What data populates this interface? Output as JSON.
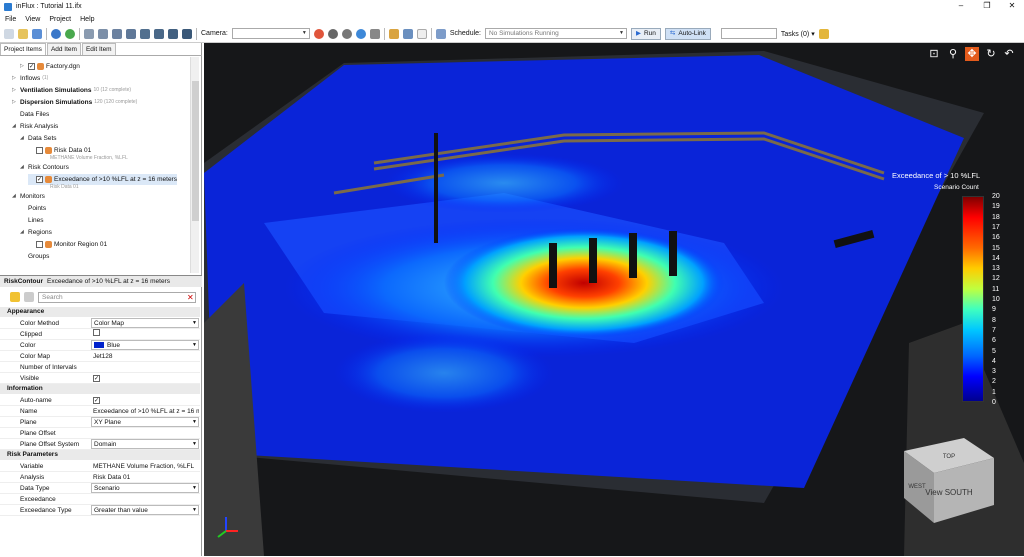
{
  "window": {
    "title": "inFlux : Tutorial 11.ifx",
    "controls": [
      "–",
      "❐",
      "✕"
    ]
  },
  "menu": [
    "File",
    "View",
    "Project",
    "Help"
  ],
  "toolbar": {
    "camera_label": "Camera:",
    "schedule_label": "Schedule:",
    "schedule_value": "No Simulations Running",
    "run_label": "Run",
    "autolink_label": "Auto-Link",
    "tasks_label": "Tasks (0)"
  },
  "tabs": [
    "Project Items",
    "Add Item",
    "Edit Item"
  ],
  "tree": [
    {
      "label": "Factory.dgn",
      "indent": 2,
      "exp": "▷",
      "check": true
    },
    {
      "label": "Inflows",
      "indent": 1,
      "exp": "▷",
      "sub": "(1)"
    },
    {
      "label": "Ventilation Simulations",
      "indent": 1,
      "exp": "▷",
      "bold": true,
      "sub": "10 (12 complete)"
    },
    {
      "label": "Dispersion Simulations",
      "indent": 1,
      "exp": "▷",
      "bold": true,
      "sub": "120 (120 complete)"
    },
    {
      "label": "Data Files",
      "indent": 1,
      "exp": ""
    },
    {
      "label": "Risk Analysis",
      "indent": 1,
      "exp": "◢"
    },
    {
      "label": "Data Sets",
      "indent": 2,
      "exp": "◢"
    },
    {
      "label": "Risk Data 01",
      "indent": 3,
      "exp": "",
      "check": false,
      "sub2": "METHANE Volume Fraction, %LFL"
    },
    {
      "label": "Risk Contours",
      "indent": 2,
      "exp": "◢"
    },
    {
      "label": "Exceedance of >10 %LFL at z = 16 meters",
      "indent": 3,
      "exp": "",
      "check": true,
      "sub2": "Risk Data 01",
      "selected": true
    },
    {
      "label": "Monitors",
      "indent": 1,
      "exp": "◢"
    },
    {
      "label": "Points",
      "indent": 2,
      "exp": ""
    },
    {
      "label": "Lines",
      "indent": 2,
      "exp": ""
    },
    {
      "label": "Regions",
      "indent": 2,
      "exp": "◢"
    },
    {
      "label": "Monitor Region 01",
      "indent": 3,
      "exp": "",
      "check": false
    },
    {
      "label": "Groups",
      "indent": 2,
      "exp": ""
    }
  ],
  "props": {
    "header_type": "RiskContour",
    "header_name": "Exceedance of >10 %LFL at z = 16 meters",
    "search_placeholder": "Search",
    "rows": [
      {
        "section": "Appearance"
      },
      {
        "label": "Color Method",
        "value": "Color Map",
        "dd": true
      },
      {
        "label": "Clipped",
        "check": false
      },
      {
        "label": "Color",
        "value": "Blue",
        "swatch": "#0022cc",
        "dd": true
      },
      {
        "label": "Color Map",
        "value": "Jet128",
        "exp": "▷"
      },
      {
        "label": "Number of Intervals",
        "value": "20",
        "spin": true
      },
      {
        "label": "Visible",
        "check": true
      },
      {
        "section": "Information"
      },
      {
        "label": "Auto-name",
        "check": true
      },
      {
        "label": "Name",
        "value": "Exceedance of >10 %LFL at z = 16 m"
      },
      {
        "label": "Plane",
        "value": "XY Plane",
        "dd": true
      },
      {
        "label": "Plane Offset",
        "value": "16 meters",
        "spin": true
      },
      {
        "label": "Plane Offset System",
        "value": "Domain",
        "dd": true
      },
      {
        "section": "Risk Parameters"
      },
      {
        "label": "Variable",
        "value": "METHANE Volume Fraction, %LFL"
      },
      {
        "label": "Analysis",
        "value": "Risk Data 01"
      },
      {
        "label": "Data Type",
        "value": "Scenario",
        "dd": true
      },
      {
        "label": "Exceedance",
        "value": "10",
        "spin": true
      },
      {
        "label": "Exceedance Type",
        "value": "Greater than value",
        "dd": true
      }
    ]
  },
  "legend": {
    "title": "Exceedance of > 10 %LFL",
    "subtitle": "Scenario Count",
    "ticks": [
      "20",
      "19",
      "18",
      "17",
      "16",
      "15",
      "14",
      "13",
      "12",
      "11",
      "10",
      "9",
      "8",
      "7",
      "6",
      "5",
      "4",
      "3",
      "2",
      "1",
      "0"
    ]
  },
  "viewcube": {
    "front": "View SOUTH",
    "top": "TOP",
    "left": "WEST"
  }
}
